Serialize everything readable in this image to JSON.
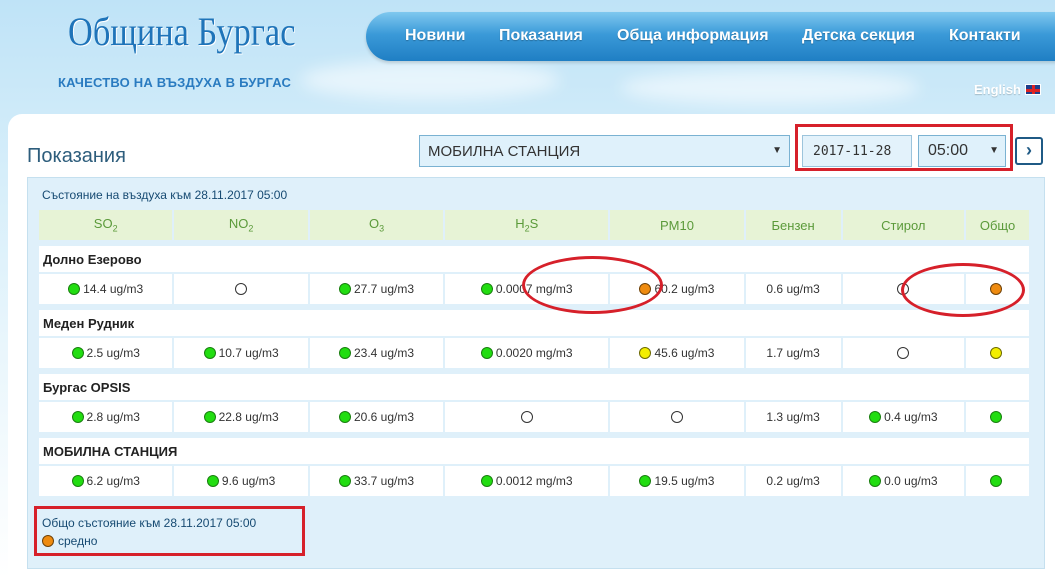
{
  "header": {
    "logo": "Община Бургас",
    "subtitle": "КАЧЕСТВО НА ВЪЗДУХА В БУРГАС",
    "nav": [
      "Новини",
      "Показания",
      "Обща информация",
      "Детска секция",
      "Контакти"
    ],
    "language": "English"
  },
  "page": {
    "title": "Показания",
    "station_select": "МОБИЛНА СТАНЦИЯ",
    "date": "2017-11-28",
    "time": "05:00",
    "next_button": "›"
  },
  "status": {
    "heading": "Състояние на въздуха към 28.11.2017 05:00",
    "columns": [
      "SO",
      "NO",
      "O",
      "H",
      "PM10",
      "Бензен",
      "Стирол",
      "Общо"
    ],
    "column_subs": [
      "2",
      "2",
      "3",
      "2",
      "",
      "",
      "",
      ""
    ],
    "column_after_sub": [
      "",
      "",
      "",
      "S",
      "",
      "",
      "",
      ""
    ],
    "stations": [
      {
        "name": "Долно Езерово",
        "cells": [
          {
            "value": "14.4 ug/m3",
            "status": "green"
          },
          {
            "value": "",
            "status": "empty"
          },
          {
            "value": "27.7 ug/m3",
            "status": "green"
          },
          {
            "value": "0.0007 mg/m3",
            "status": "green"
          },
          {
            "value": "60.2 ug/m3",
            "status": "orange"
          },
          {
            "value": "0.6 ug/m3",
            "status": "none"
          },
          {
            "value": "",
            "status": "empty"
          },
          {
            "value": "",
            "status": "orange"
          }
        ]
      },
      {
        "name": "Меден Рудник",
        "cells": [
          {
            "value": "2.5 ug/m3",
            "status": "green"
          },
          {
            "value": "10.7 ug/m3",
            "status": "green"
          },
          {
            "value": "23.4 ug/m3",
            "status": "green"
          },
          {
            "value": "0.0020 mg/m3",
            "status": "green"
          },
          {
            "value": "45.6 ug/m3",
            "status": "yellow"
          },
          {
            "value": "1.7 ug/m3",
            "status": "none"
          },
          {
            "value": "",
            "status": "empty"
          },
          {
            "value": "",
            "status": "yellow"
          }
        ]
      },
      {
        "name": "Бургас OPSIS",
        "cells": [
          {
            "value": "2.8 ug/m3",
            "status": "green"
          },
          {
            "value": "22.8 ug/m3",
            "status": "green"
          },
          {
            "value": "20.6 ug/m3",
            "status": "green"
          },
          {
            "value": "",
            "status": "empty"
          },
          {
            "value": "",
            "status": "empty"
          },
          {
            "value": "1.3 ug/m3",
            "status": "none"
          },
          {
            "value": "0.4 ug/m3",
            "status": "green"
          },
          {
            "value": "",
            "status": "green"
          }
        ]
      },
      {
        "name": "МОБИЛНА СТАНЦИЯ",
        "cells": [
          {
            "value": "6.2 ug/m3",
            "status": "green"
          },
          {
            "value": "9.6 ug/m3",
            "status": "green"
          },
          {
            "value": "33.7 ug/m3",
            "status": "green"
          },
          {
            "value": "0.0012 mg/m3",
            "status": "green"
          },
          {
            "value": "19.5 ug/m3",
            "status": "green"
          },
          {
            "value": "0.2 ug/m3",
            "status": "none"
          },
          {
            "value": "0.0 ug/m3",
            "status": "green"
          },
          {
            "value": "",
            "status": "green"
          }
        ]
      }
    ]
  },
  "overall": {
    "label": "Общо състояние към 28.11.2017 05:00",
    "value": "средно",
    "status": "orange"
  },
  "colors": {
    "green": "#22dd11",
    "orange": "#ee8b10",
    "yellow": "#f3ee00",
    "annotation_red": "#d6202a"
  }
}
